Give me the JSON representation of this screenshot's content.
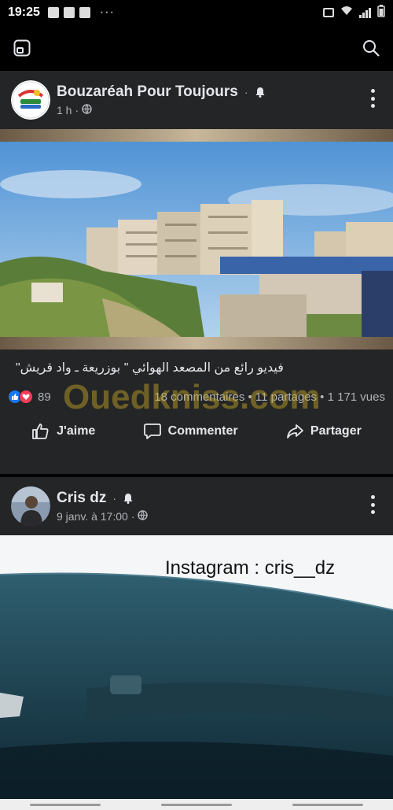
{
  "status_bar": {
    "time": "19:25",
    "dots": "···"
  },
  "post1": {
    "page_name": "Bouzaréah Pour Toujours",
    "time": "1 h",
    "privacy_sep": "·",
    "caption": "فيديو رائع من المصعد الهوائي \" بوزريعة ـ واد قريش\"",
    "reaction_count": "89",
    "stats": "18 commentaires • 11 partages • 1 171 vues",
    "watermark": "Ouedkniss.com"
  },
  "actions": {
    "like": "J'aime",
    "comment": "Commenter",
    "share": "Partager"
  },
  "post2": {
    "page_name": "Cris dz",
    "time": "9 janv. à 17:00",
    "privacy_sep": "·",
    "overlay_text": "Instagram : cris__dz"
  },
  "colors": {
    "background": "#000000",
    "card": "#242526",
    "text": "#e4e6eb",
    "secondary_text": "#b0b3b8",
    "like_blue": "#1877f2",
    "love_red": "#f33e58"
  }
}
